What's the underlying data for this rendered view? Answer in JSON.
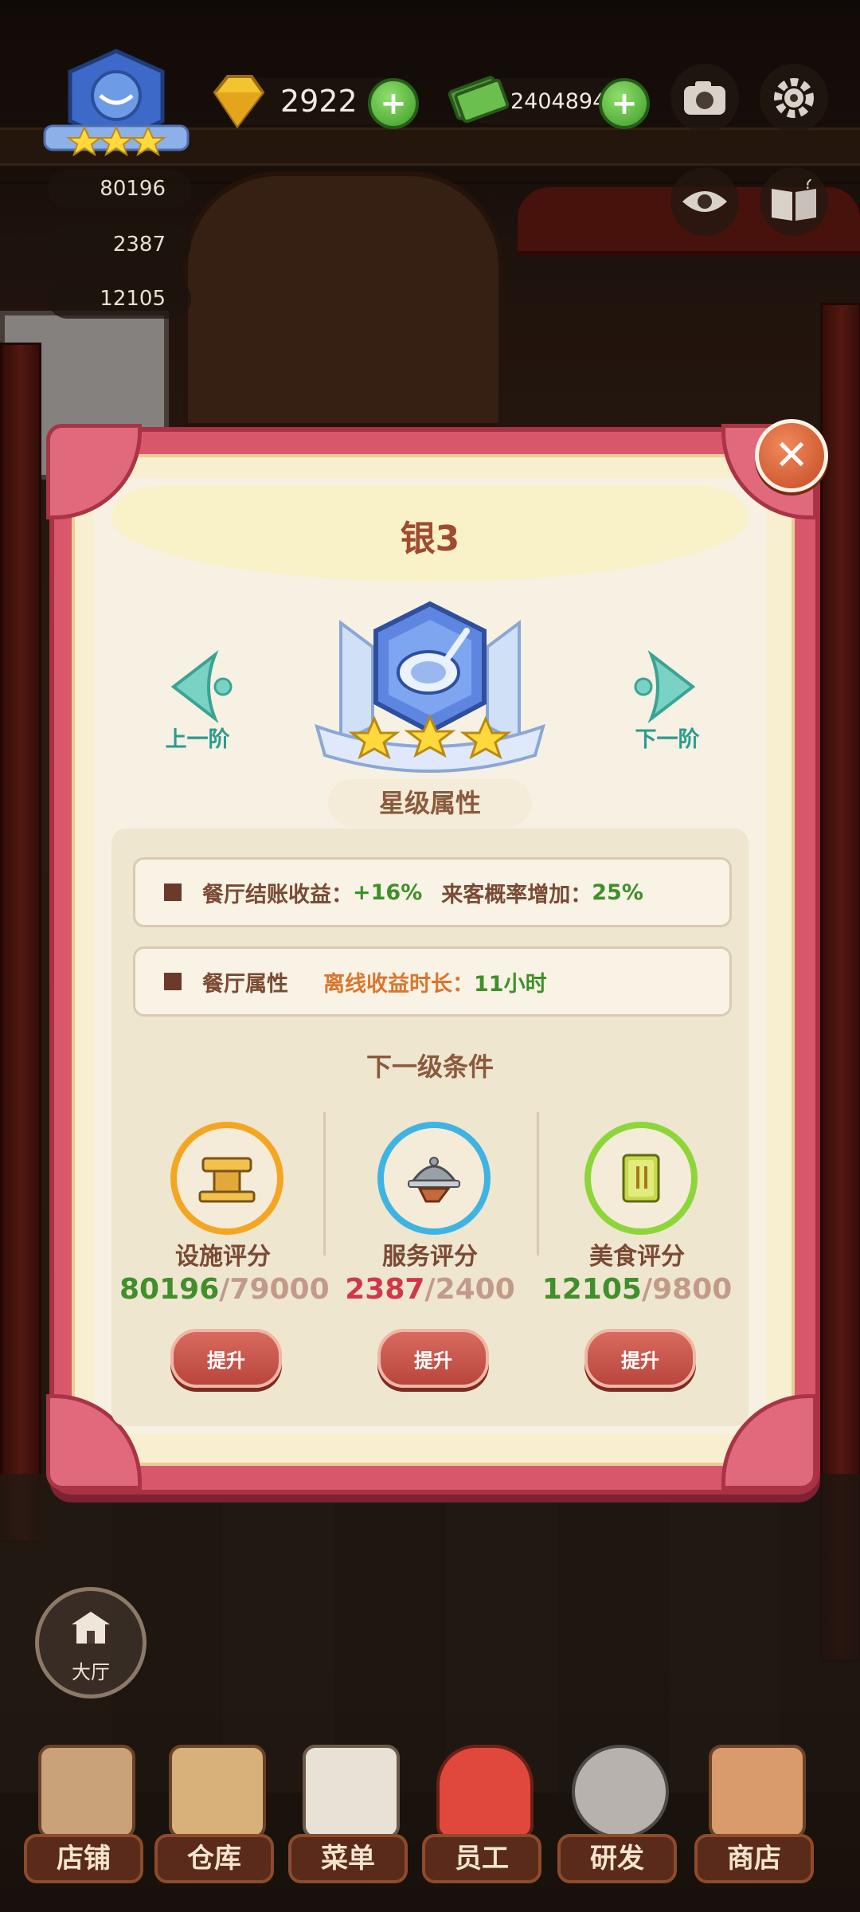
{
  "hud": {
    "diamonds": "2922",
    "cash": "24048949",
    "facility_score": "80196",
    "service_score": "2387",
    "food_score": "12105",
    "rank_stars": 3
  },
  "dialog": {
    "title": "银3",
    "prev_label": "上一阶",
    "next_label": "下一阶",
    "badge_stars": 3,
    "section_title": "星级属性",
    "attr1": {
      "label": "餐厅结账收益：",
      "value1": "+16%",
      "label2": "来客概率增加：",
      "value2": "25%"
    },
    "attr2": {
      "label": "餐厅属性",
      "offline_label": "离线收益时长：",
      "offline_value": "11小时"
    },
    "conditions_title": "下一级条件",
    "conditions": [
      {
        "label": "设施评分",
        "current": "80196",
        "required": "/79000",
        "button": "提升",
        "current_color": "#3f8f2a"
      },
      {
        "label": "服务评分",
        "current": "2387",
        "required": "/2400",
        "button": "提升",
        "current_color": "#d0384a"
      },
      {
        "label": "美食评分",
        "current": "12105",
        "required": "/9800",
        "button": "提升",
        "current_color": "#3f8f2a"
      }
    ]
  },
  "hall_label": "大厅",
  "bottom_nav": [
    {
      "label": "店铺"
    },
    {
      "label": "仓库"
    },
    {
      "label": "菜单"
    },
    {
      "label": "员工"
    },
    {
      "label": "研发"
    },
    {
      "label": "商店"
    }
  ],
  "colors": {
    "accent_red": "#d9576a",
    "teal": "#2a9b8f",
    "green": "#3f8f2a",
    "orange": "#d9762f",
    "brown_text": "#7a4a34"
  },
  "icons": [
    "crest-badge-icon",
    "gem-icon",
    "cash-icon",
    "plus-icon",
    "camera-icon",
    "gear-icon",
    "eye-icon",
    "guide-book-icon",
    "facility-icon",
    "cloche-icon",
    "recipe-book-icon",
    "close-icon"
  ]
}
